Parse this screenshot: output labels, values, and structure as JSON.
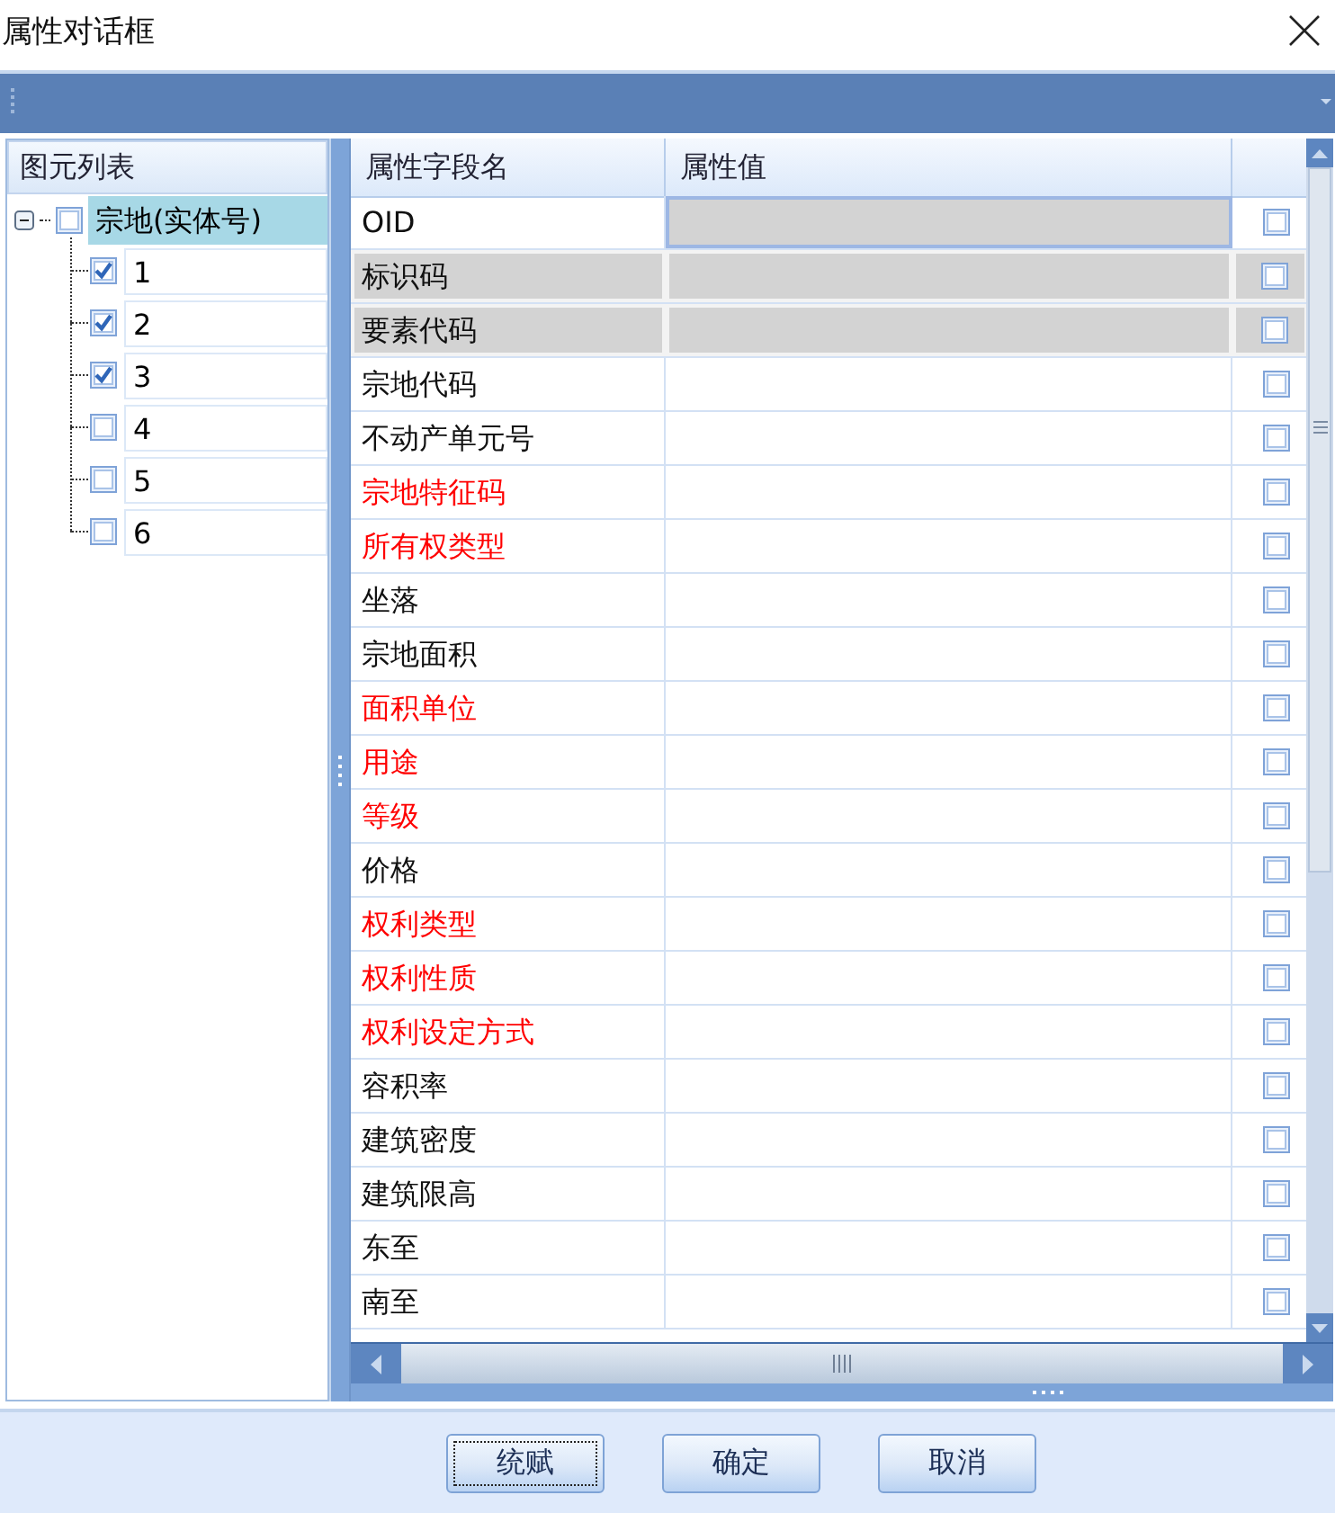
{
  "window": {
    "title": "属性对话框"
  },
  "tree": {
    "header": "图元列表",
    "root": {
      "label": "宗地(实体号)",
      "checked": false,
      "selected": true,
      "expanded": true,
      "children": [
        {
          "label": "1",
          "checked": true,
          "selected": false
        },
        {
          "label": "2",
          "checked": true,
          "selected": false
        },
        {
          "label": "3",
          "checked": true,
          "selected": false
        },
        {
          "label": "4",
          "checked": false,
          "selected": false
        },
        {
          "label": "5",
          "checked": false,
          "selected": false
        },
        {
          "label": "6",
          "checked": false,
          "selected": false
        }
      ]
    }
  },
  "grid": {
    "columns": [
      "属性字段名",
      "属性值"
    ],
    "rows": [
      {
        "name": "OID",
        "required": false,
        "readonly": true,
        "selected": true,
        "checked": false
      },
      {
        "name": "标识码",
        "required": false,
        "readonly": true,
        "selected": false,
        "checked": false
      },
      {
        "name": "要素代码",
        "required": false,
        "readonly": true,
        "selected": false,
        "checked": false
      },
      {
        "name": "宗地代码",
        "required": false,
        "readonly": false,
        "selected": false,
        "checked": false
      },
      {
        "name": "不动产单元号",
        "required": false,
        "readonly": false,
        "selected": false,
        "checked": false
      },
      {
        "name": "宗地特征码",
        "required": true,
        "readonly": false,
        "selected": false,
        "checked": false
      },
      {
        "name": "所有权类型",
        "required": true,
        "readonly": false,
        "selected": false,
        "checked": false
      },
      {
        "name": "坐落",
        "required": false,
        "readonly": false,
        "selected": false,
        "checked": false
      },
      {
        "name": "宗地面积",
        "required": false,
        "readonly": false,
        "selected": false,
        "checked": false
      },
      {
        "name": "面积单位",
        "required": true,
        "readonly": false,
        "selected": false,
        "checked": false
      },
      {
        "name": "用途",
        "required": true,
        "readonly": false,
        "selected": false,
        "checked": false
      },
      {
        "name": "等级",
        "required": true,
        "readonly": false,
        "selected": false,
        "checked": false
      },
      {
        "name": "价格",
        "required": false,
        "readonly": false,
        "selected": false,
        "checked": false
      },
      {
        "name": "权利类型",
        "required": true,
        "readonly": false,
        "selected": false,
        "checked": false
      },
      {
        "name": "权利性质",
        "required": true,
        "readonly": false,
        "selected": false,
        "checked": false
      },
      {
        "name": "权利设定方式",
        "required": true,
        "readonly": false,
        "selected": false,
        "checked": false
      },
      {
        "name": "容积率",
        "required": false,
        "readonly": false,
        "selected": false,
        "checked": false
      },
      {
        "name": "建筑密度",
        "required": false,
        "readonly": false,
        "selected": false,
        "checked": false
      },
      {
        "name": "建筑限高",
        "required": false,
        "readonly": false,
        "selected": false,
        "checked": false
      },
      {
        "name": "东至",
        "required": false,
        "readonly": false,
        "selected": false,
        "checked": false
      },
      {
        "name": "南至",
        "required": false,
        "readonly": false,
        "selected": false,
        "checked": false
      }
    ]
  },
  "buttons": [
    "统赋",
    "确定",
    "取消"
  ]
}
